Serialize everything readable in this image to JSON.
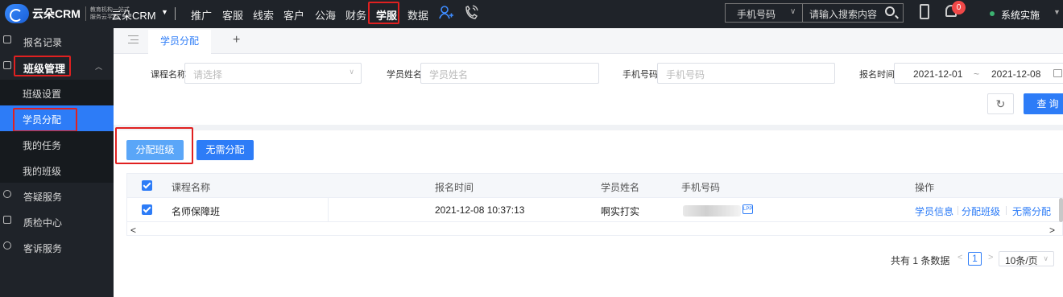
{
  "topbar": {
    "logo_text": "云朵CRM",
    "logo_sub": "教育机构一站式服务云平台",
    "brand": "云朵CRM",
    "brand_caret": "▼",
    "nav": [
      {
        "label": "推广"
      },
      {
        "label": "客服"
      },
      {
        "label": "线索"
      },
      {
        "label": "客户"
      },
      {
        "label": "公海"
      },
      {
        "label": "财务"
      },
      {
        "label": "学服",
        "active": true
      },
      {
        "label": "数据"
      }
    ],
    "search_type": "手机号码",
    "search_placeholder": "请输入搜索内容",
    "notification_count": "0",
    "user_name": "系统实施"
  },
  "sidebar": {
    "items": [
      {
        "label": "报名记录",
        "icon": "printer-icon"
      },
      {
        "label": "班级管理",
        "icon": "class-icon",
        "expanded": true
      },
      {
        "label": "答疑服务",
        "icon": "info-circle-icon"
      },
      {
        "label": "质检中心",
        "icon": "check-square-icon"
      },
      {
        "label": "客诉服务",
        "icon": "alert-circle-icon"
      }
    ],
    "sub_items": [
      {
        "label": "班级设置"
      },
      {
        "label": "学员分配",
        "active": true
      },
      {
        "label": "我的任务"
      },
      {
        "label": "我的班级"
      }
    ]
  },
  "tabs": {
    "active": "学员分配",
    "add": "+"
  },
  "filters": {
    "course_label": "课程名称",
    "course_placeholder": "请选择",
    "student_label": "学员姓名",
    "student_placeholder": "学员姓名",
    "phone_label": "手机号码",
    "phone_placeholder": "手机号码",
    "date_label": "报名时间",
    "date_start": "2021-12-01",
    "date_sep": "~",
    "date_end": "2021-12-08",
    "reset_icon": "↻",
    "query_label": "查 询"
  },
  "actions": {
    "assign_class": "分配班级",
    "no_assign": "无需分配"
  },
  "table": {
    "headers": {
      "course": "课程名称",
      "time": "报名时间",
      "student": "学员姓名",
      "phone": "手机号码",
      "ops": "操作"
    },
    "rows": [
      {
        "course": "名师保障班",
        "time": "2021-12-08 10:37:13",
        "student": "啊实打实",
        "phone_tag": "LPP",
        "ops": [
          "学员信息",
          "分配班级",
          "无需分配"
        ]
      }
    ]
  },
  "pagination": {
    "total": "共有 1 条数据",
    "page": "1",
    "page_size": "10条/页"
  },
  "colors": {
    "primary": "#2d7cf7",
    "sidebar_bg": "#1f2329",
    "highlight_box": "#e02020"
  }
}
